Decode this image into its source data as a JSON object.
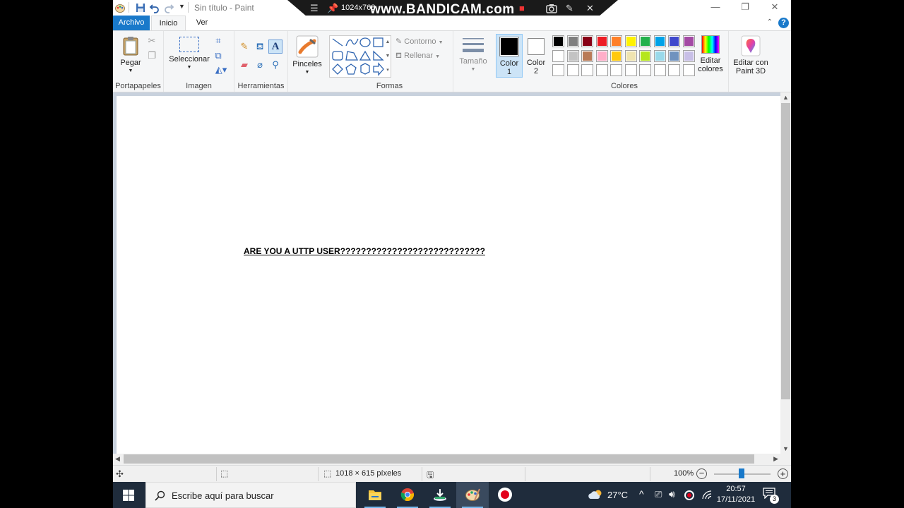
{
  "window": {
    "title": "Sin título - Paint",
    "minimize": "—",
    "maximize": "❐",
    "close": "✕"
  },
  "bandicam": {
    "resolution": "1024x768",
    "brand": "www.BANDICAM.com"
  },
  "tabs": {
    "file": "Archivo",
    "home": "Inicio",
    "view": "Ver",
    "help": "?"
  },
  "ribbon": {
    "clipboard": {
      "paste": "Pegar",
      "group": "Portapapeles"
    },
    "image": {
      "select": "Seleccionar",
      "group": "Imagen"
    },
    "tools": {
      "group": "Herramientas"
    },
    "brushes": {
      "label": "Pinceles"
    },
    "shapes": {
      "outline": "Contorno",
      "fill": "Rellenar",
      "group": "Formas"
    },
    "size": {
      "label": "Tamaño"
    },
    "color1": {
      "line1": "Color",
      "line2": "1",
      "value": "#000000"
    },
    "color2": {
      "line1": "Color",
      "line2": "2",
      "value": "#ffffff"
    },
    "colors": {
      "group": "Colores",
      "row1": [
        "#000000",
        "#7f7f7f",
        "#880015",
        "#ed1c24",
        "#ff7f27",
        "#fff200",
        "#22b14c",
        "#00a2e8",
        "#3f48cc",
        "#a349a4"
      ],
      "row2": [
        "#ffffff",
        "#c3c3c3",
        "#b97a57",
        "#ffaec9",
        "#ffc90e",
        "#efe4b0",
        "#b5e61d",
        "#99d9ea",
        "#7092be",
        "#c8bfe7"
      ],
      "edit_line1": "Editar",
      "edit_line2": "colores"
    },
    "paint3d": {
      "line1": "Editar con",
      "line2": "Paint 3D"
    }
  },
  "canvas": {
    "text": "ARE YOU A UTTP USER????????????????????????????"
  },
  "statusbar": {
    "dimensions": "1018 × 615 píxeles",
    "zoom": "100%"
  },
  "taskbar": {
    "search_placeholder": "Escribe aquí para buscar",
    "temperature": "27°C",
    "time": "20:57",
    "date": "17/11/2021",
    "notification_count": "3"
  }
}
